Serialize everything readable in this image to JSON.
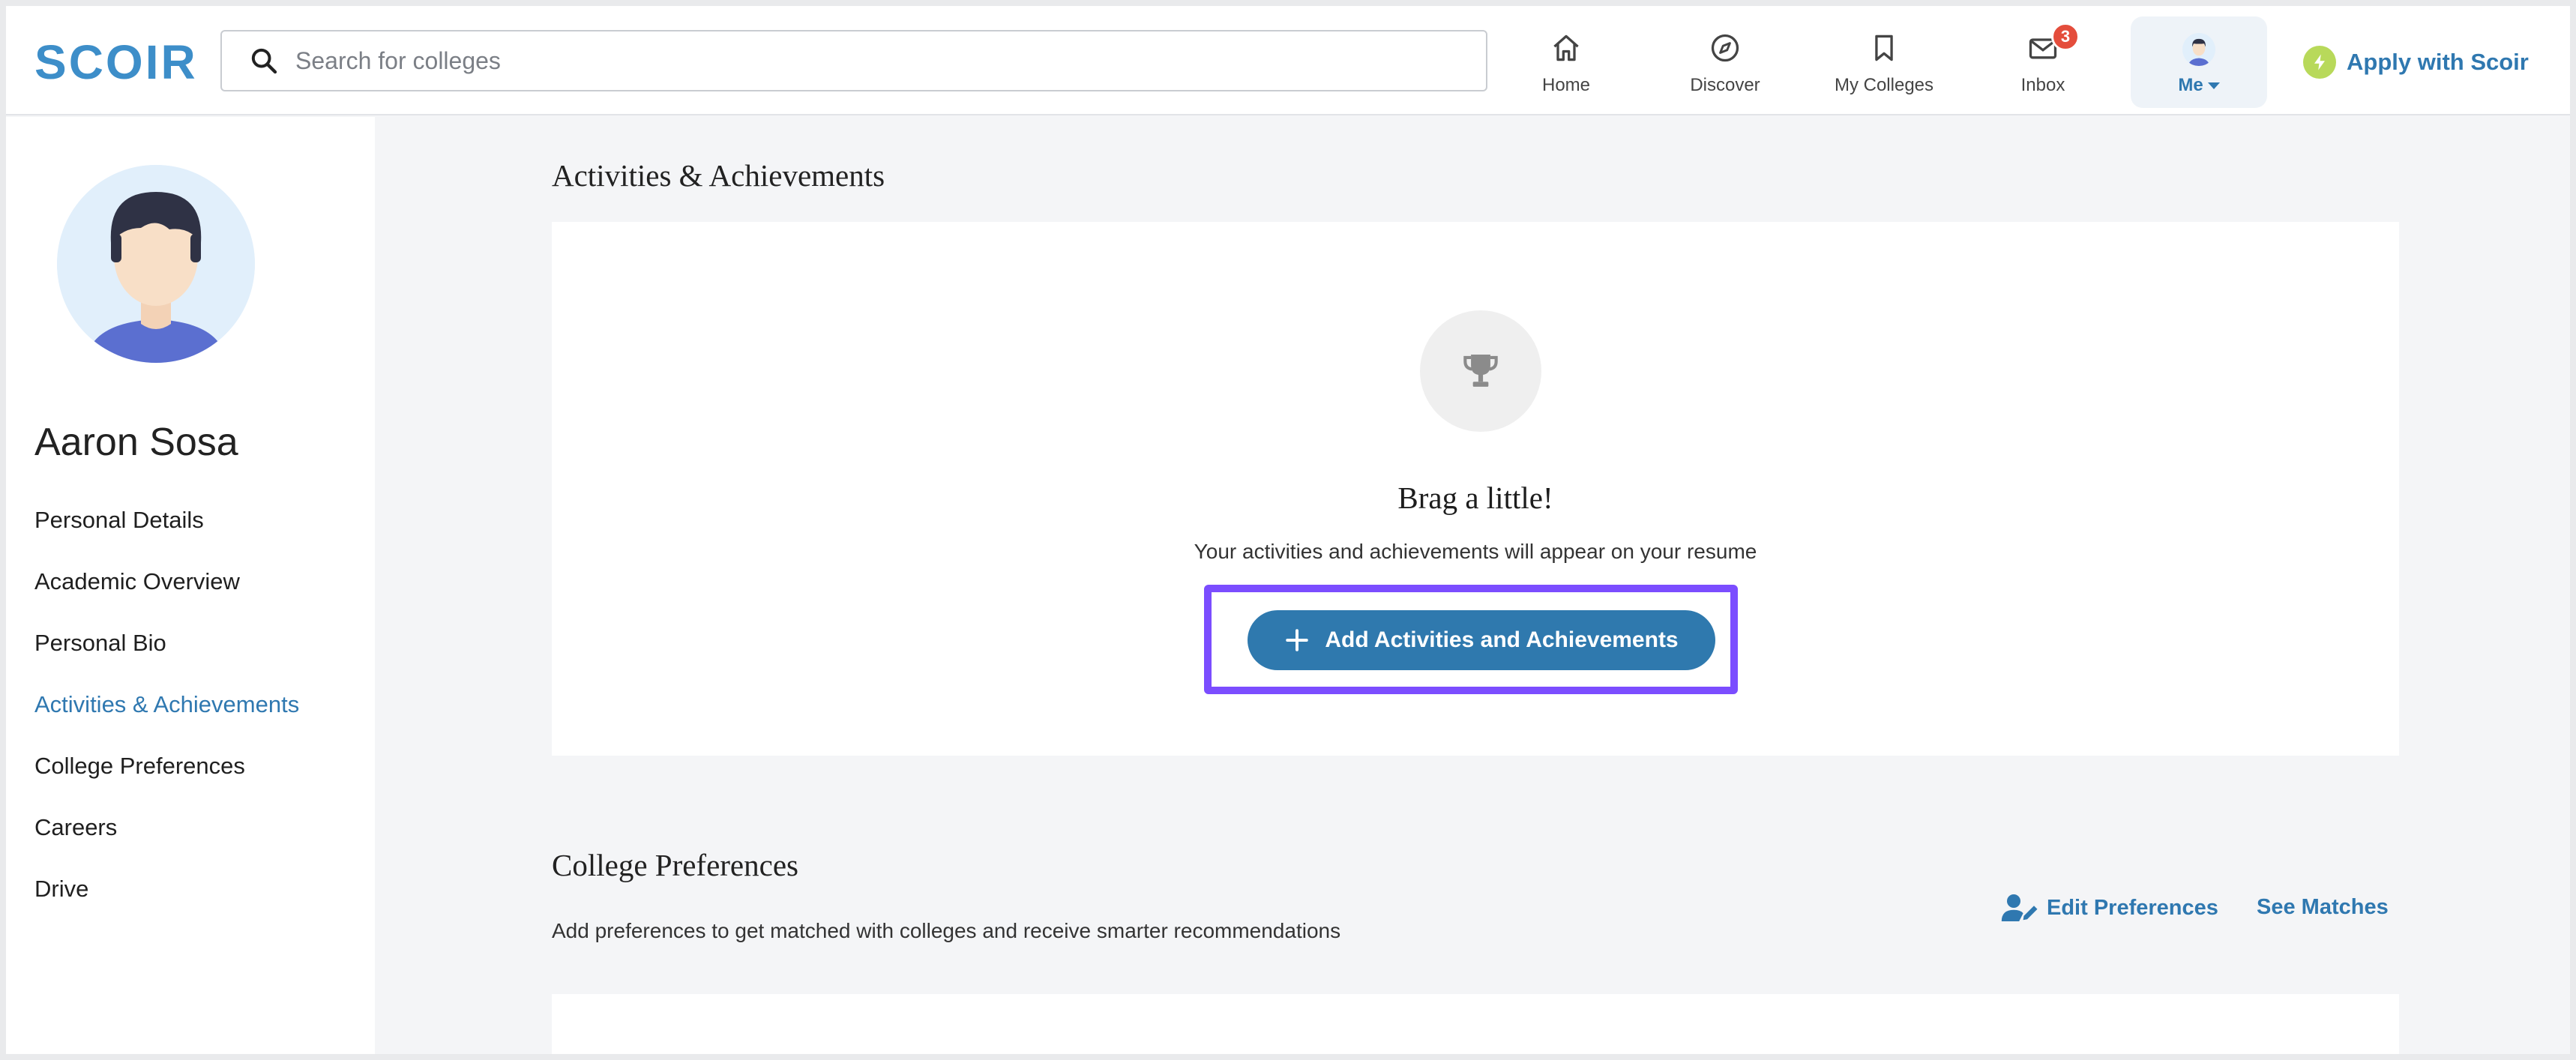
{
  "header": {
    "logo_text": "SCOIR",
    "search": {
      "placeholder": "Search for colleges",
      "value": ""
    },
    "nav": {
      "home": "Home",
      "discover": "Discover",
      "my_colleges": "My Colleges",
      "inbox": "Inbox",
      "inbox_badge": "3",
      "me": "Me"
    },
    "apply_label": "Apply with Scoir"
  },
  "sidebar": {
    "profile_name": "Aaron Sosa",
    "items": [
      {
        "label": "Personal Details"
      },
      {
        "label": "Academic Overview"
      },
      {
        "label": "Personal Bio"
      },
      {
        "label": "Activities & Achievements"
      },
      {
        "label": "College Preferences"
      },
      {
        "label": "Careers"
      },
      {
        "label": "Drive"
      }
    ],
    "active_item": "Activities & Achievements"
  },
  "main": {
    "activities": {
      "title": "Activities & Achievements",
      "empty_title": "Brag a little!",
      "empty_subtitle": "Your activities and achievements will appear on your resume",
      "add_button_label": "Add Activities and Achievements"
    },
    "preferences": {
      "title": "College Preferences",
      "description": "Add preferences to get matched with colleges and receive smarter recommendations",
      "edit_label": "Edit Preferences",
      "see_matches_label": "See Matches"
    }
  },
  "colors": {
    "brand_blue": "#2f78b0",
    "button_blue": "#2f79ae",
    "highlight_purple": "#7b4dff",
    "badge_red": "#e44d3c",
    "apply_green": "#b8d95a"
  },
  "icons": [
    "search-icon",
    "home-icon",
    "compass-icon",
    "bookmark-icon",
    "envelope-icon",
    "lightning-icon",
    "trophy-icon",
    "plus-icon",
    "user-edit-icon"
  ]
}
